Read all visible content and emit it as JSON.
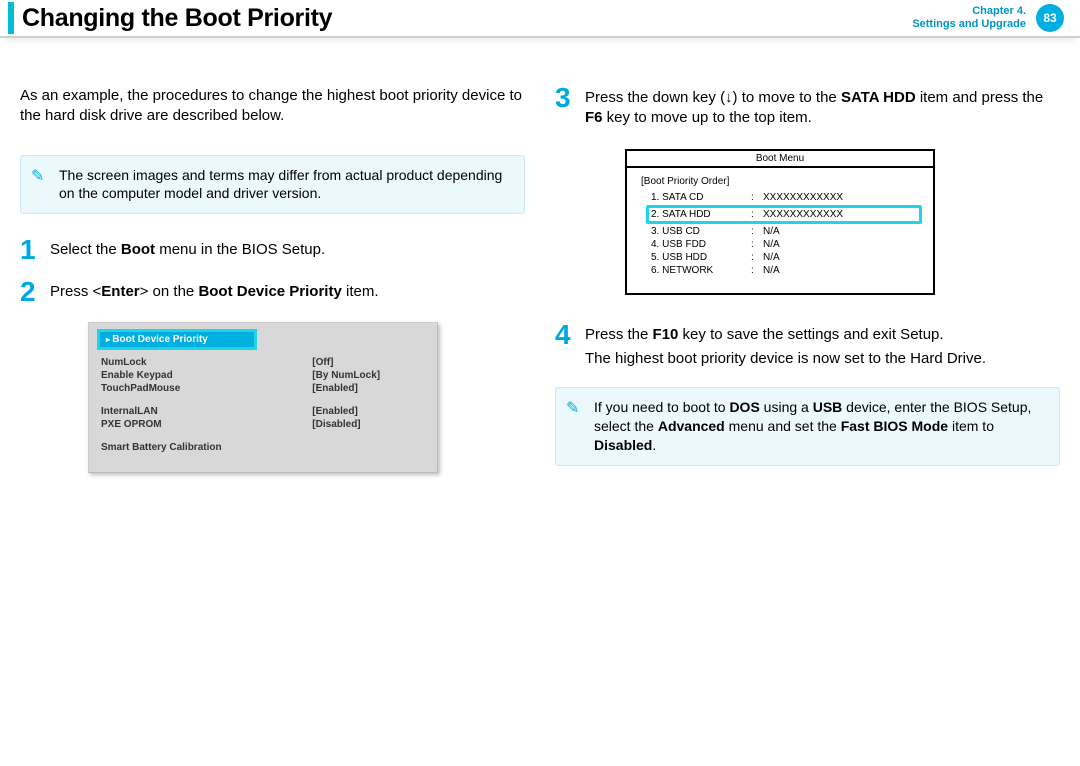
{
  "header": {
    "title": "Changing the Boot Priority",
    "chapter_line1": "Chapter 4.",
    "chapter_line2": "Settings and Upgrade",
    "page_number": "83"
  },
  "left": {
    "intro": "As an example, the procedures to change the highest boot priority device to the hard disk drive are described below.",
    "note": "The screen images and terms may differ from actual product depending on the computer model and driver version.",
    "step1": {
      "num": "1",
      "prefix": "Select the ",
      "bold": "Boot",
      "suffix": " menu in the BIOS Setup."
    },
    "step2": {
      "num": "2",
      "prefix": "Press <",
      "bold1": "Enter",
      "mid": "> on the ",
      "bold2": "Boot Device Priority",
      "suffix": " item."
    },
    "bios_panel": {
      "selected": "Boot Device Priority",
      "rows_a": [
        {
          "k": "NumLock",
          "v": "[Off]"
        },
        {
          "k": "Enable Keypad",
          "v": "[By NumLock]"
        },
        {
          "k": "TouchPadMouse",
          "v": "[Enabled]"
        }
      ],
      "rows_b": [
        {
          "k": "InternalLAN",
          "v": "[Enabled]"
        },
        {
          "k": "PXE OPROM",
          "v": "[Disabled]"
        }
      ],
      "rows_c": [
        {
          "k": "Smart Battery Calibration",
          "v": ""
        }
      ]
    }
  },
  "right": {
    "step3": {
      "num": "3",
      "prefix": "Press the down key (↓) to move to the ",
      "bold1": "SATA HDD",
      "mid": " item and press the ",
      "bold2": "F6",
      "suffix": " key to move up to the top item."
    },
    "boot_menu": {
      "title": "Boot Menu",
      "subtitle": "[Boot Priority Order]",
      "items": [
        {
          "k": "1. SATA CD",
          "v": "XXXXXXXXXXXX",
          "hl": false
        },
        {
          "k": "2. SATA HDD",
          "v": "XXXXXXXXXXXX",
          "hl": true
        },
        {
          "k": "3. USB CD",
          "v": "N/A",
          "hl": false
        },
        {
          "k": "4. USB FDD",
          "v": "N/A",
          "hl": false
        },
        {
          "k": "5. USB HDD",
          "v": "N/A",
          "hl": false
        },
        {
          "k": "6. NETWORK",
          "v": "N/A",
          "hl": false
        }
      ]
    },
    "step4": {
      "num": "4",
      "l1_prefix": "Press the ",
      "l1_bold": "F10",
      "l1_suffix": " key to save the settings and exit Setup.",
      "l2": "The highest boot priority device is now set to the Hard Drive."
    },
    "note2": {
      "p1": "If you need to boot to ",
      "b1": "DOS",
      "p2": " using a ",
      "b2": "USB",
      "p3": " device, enter the BIOS Setup, select the ",
      "b3": "Advanced",
      "p4": " menu and set the ",
      "b4": "Fast BIOS Mode",
      "p5": " item to ",
      "b5": "Disabled",
      "p6": "."
    }
  }
}
